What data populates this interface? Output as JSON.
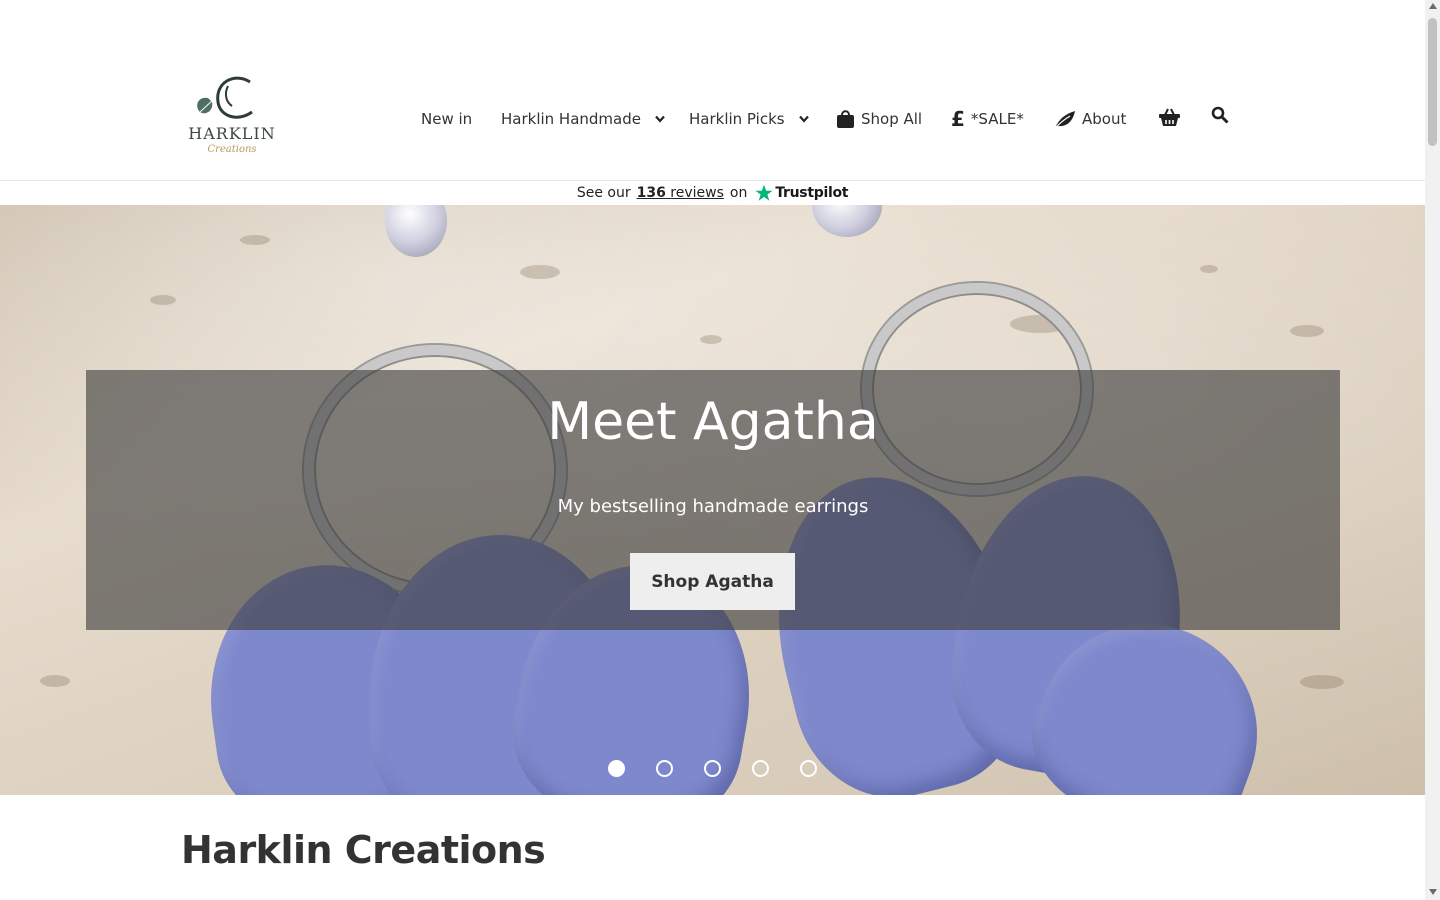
{
  "logo": {
    "name": "HARKLIN",
    "sub": "Creations"
  },
  "nav": {
    "new_in": "New in",
    "handmade": "Harklin Handmade",
    "picks": "Harklin Picks",
    "shop_all": "Shop All",
    "sale": "*SALE*",
    "about": "About"
  },
  "trustpilot": {
    "prefix": "See our",
    "count": "136",
    "reviews": "reviews",
    "on": "on",
    "brand": "Trustpilot",
    "brand_color": "#00b67a"
  },
  "hero": {
    "title": "Meet Agatha",
    "subtitle": "My bestselling handmade earrings",
    "button": "Shop Agatha",
    "slides": 5,
    "active_slide": 1
  },
  "section": {
    "heading": "Harklin Creations"
  },
  "colors": {
    "logo_green": "#3a4a45",
    "logo_gold": "#b79b57",
    "petal": "#7e88cc"
  },
  "icons": [
    "caret-down-icon",
    "shopping-bag-icon",
    "pound-icon",
    "leaf-icon",
    "basket-icon",
    "search-icon",
    "star-icon"
  ]
}
